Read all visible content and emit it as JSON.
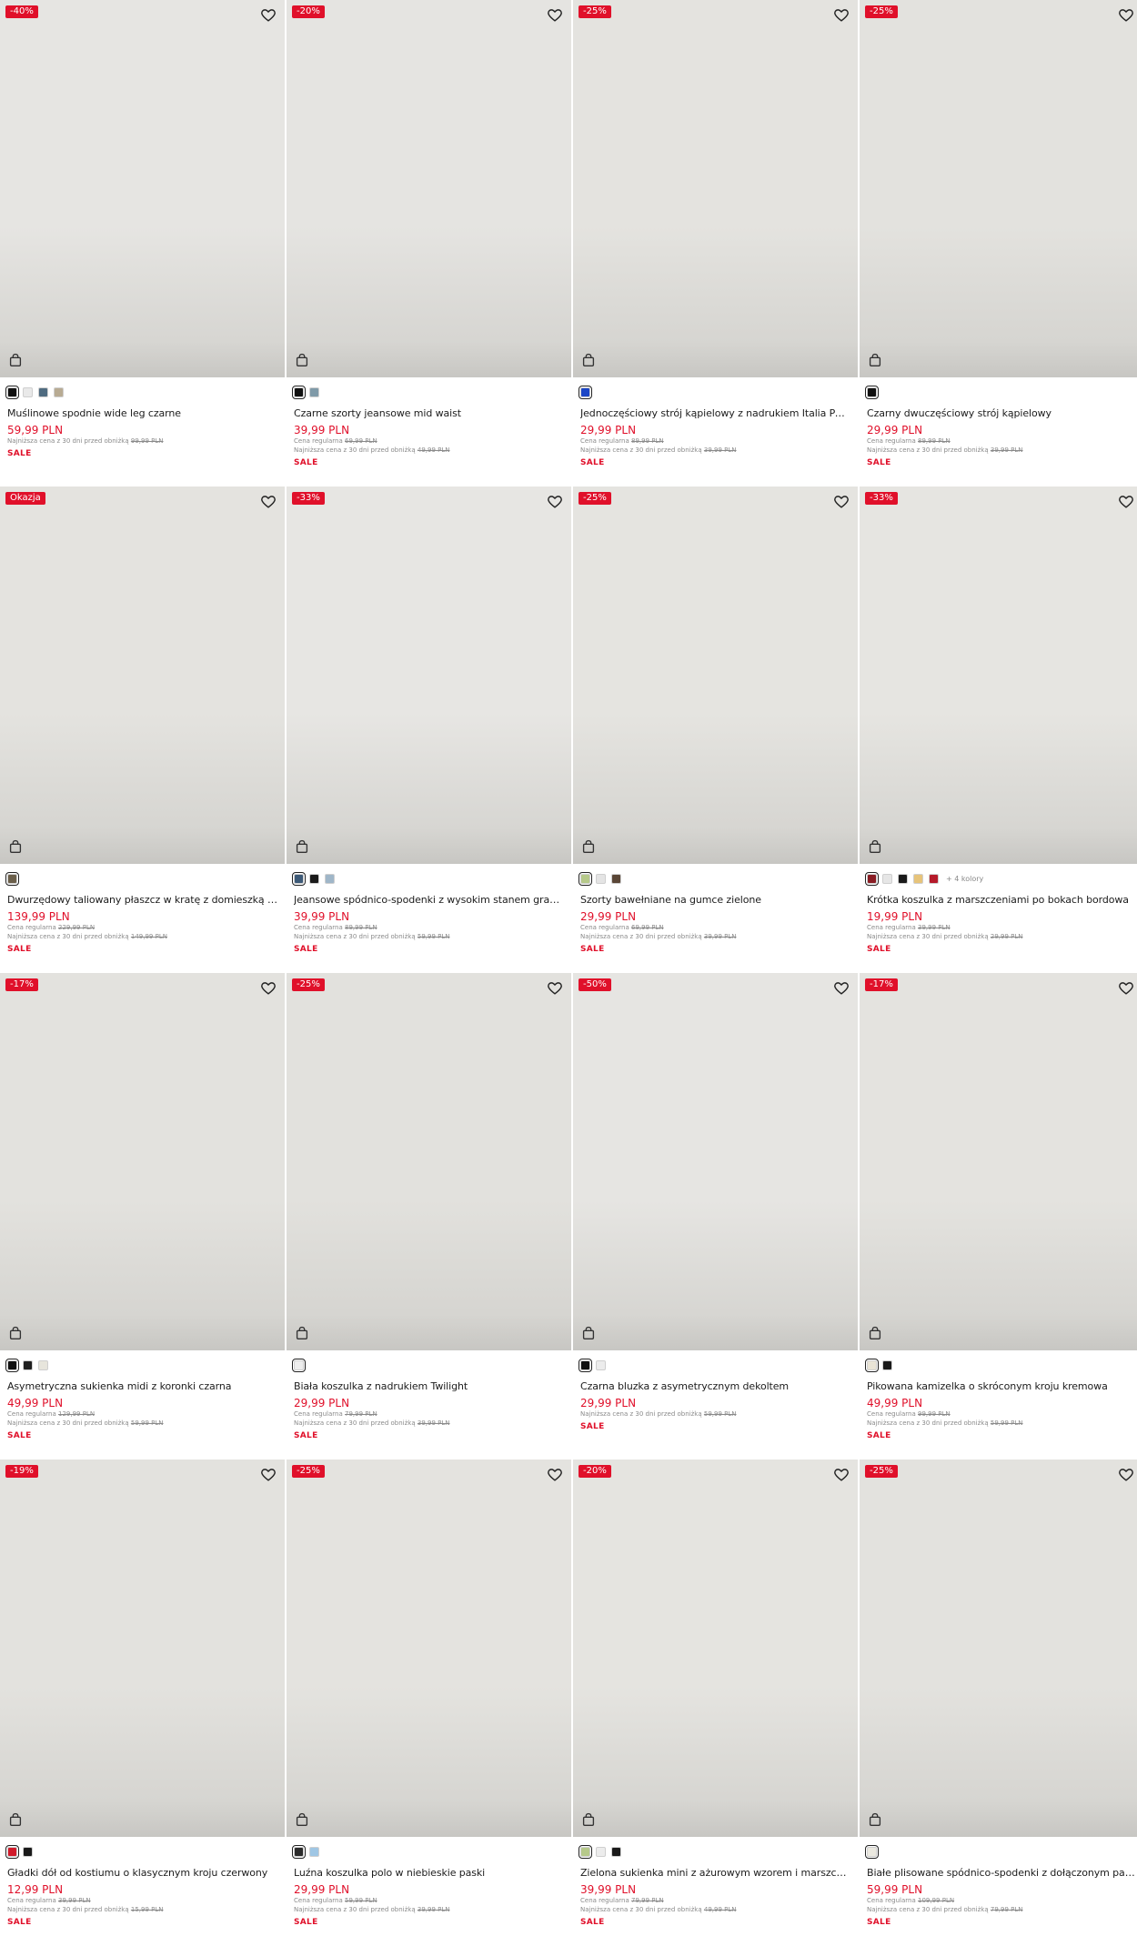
{
  "products": [
    {
      "badge": "-40%",
      "swatches": [
        "#111111",
        "#e9e9e9",
        "#4f6b80",
        "#b8ab93"
      ],
      "more": "",
      "name": "Muślinowe spodnie wide leg czarne",
      "price": "59,99 PLN",
      "regular_label": "",
      "regular_price": "",
      "lowest_label": "Najniższa cena z 30 dni przed obniżką",
      "lowest_price": "99,99 PLN",
      "sale": "SALE",
      "bg": "#e6e5e2",
      "outfit": "#1a1a1a",
      "top": "#1a1a1a",
      "bottom": "#1a1a1a",
      "pose": "long"
    },
    {
      "badge": "-20%",
      "swatches": [
        "#111111",
        "#7f9aa8"
      ],
      "more": "",
      "name": "Czarne szorty jeansowe mid waist",
      "price": "39,99 PLN",
      "regular_label": "Cena regularna",
      "regular_price": "69,99 PLN",
      "lowest_label": "Najniższa cena z 30 dni przed obniżką",
      "lowest_price": "49,99 PLN",
      "sale": "SALE",
      "bg": "#e5e4e1",
      "outfit": "#f5f5f5",
      "top": "#f5f5f5",
      "bottom": "#1a1a1a",
      "pose": "shorts"
    },
    {
      "badge": "-25%",
      "swatches": [
        "#1b46c7"
      ],
      "more": "",
      "name": "Jednoczęściowy strój kąpielowy z nadrukiem Italia Palermo",
      "price": "29,99 PLN",
      "regular_label": "Cena regularna",
      "regular_price": "89,99 PLN",
      "lowest_label": "Najniższa cena z 30 dni przed obniżką",
      "lowest_price": "39,99 PLN",
      "sale": "SALE",
      "bg": "#e4e3df",
      "outfit": "#1b46c7",
      "top": "#1b46c7",
      "bottom": "#1b46c7",
      "pose": "swim"
    },
    {
      "badge": "-25%",
      "swatches": [
        "#111111"
      ],
      "more": "",
      "name": "Czarny dwuczęściowy strój kąpielowy",
      "price": "29,99 PLN",
      "regular_label": "Cena regularna",
      "regular_price": "89,99 PLN",
      "lowest_label": "Najniższa cena z 30 dni przed obniżką",
      "lowest_price": "39,99 PLN",
      "sale": "SALE",
      "bg": "#e3e2de",
      "outfit": "#1a1a1a",
      "top": "#1a1a1a",
      "bottom": "#1a1a1a",
      "pose": "bikini"
    },
    {
      "badge": "Okazja",
      "swatches": [
        "#6b5f4a"
      ],
      "more": "",
      "name": "Dwurzędowy taliowany płaszcz w kratę z domieszką wełny",
      "price": "139,99 PLN",
      "regular_label": "Cena regularna",
      "regular_price": "229,99 PLN",
      "lowest_label": "Najniższa cena z 30 dni przed obniżką",
      "lowest_price": "149,99 PLN",
      "sale": "SALE",
      "bg": "#e4e3df",
      "outfit": "#7a6a52",
      "top": "#7a6a52",
      "bottom": "#2a2420",
      "pose": "coat"
    },
    {
      "badge": "-33%",
      "swatches": [
        "#3d5a78",
        "#1a1a1a",
        "#9fb6c8"
      ],
      "more": "",
      "name": "Jeansowe spódnico-spodenki z wysokim stanem granato...",
      "price": "39,99 PLN",
      "regular_label": "Cena regularna",
      "regular_price": "89,99 PLN",
      "lowest_label": "Najniższa cena z 30 dni przed obniżką",
      "lowest_price": "59,99 PLN",
      "sale": "SALE",
      "bg": "#e7e6e3",
      "outfit": "#4d6e8e",
      "top": "#4d6e8e",
      "bottom": "#4d6e8e",
      "pose": "flat"
    },
    {
      "badge": "-25%",
      "swatches": [
        "#b6c98a",
        "#e4e4e4",
        "#5a4636"
      ],
      "more": "",
      "name": "Szorty bawełniane na gumce zielone",
      "price": "29,99 PLN",
      "regular_label": "Cena regularna",
      "regular_price": "69,99 PLN",
      "lowest_label": "Najniższa cena z 30 dni przed obniżką",
      "lowest_price": "39,99 PLN",
      "sale": "SALE",
      "bg": "#e5e4e0",
      "outfit": "#f2f1ec",
      "top": "#f2f1ec",
      "bottom": "#b8cc8a",
      "pose": "shorts"
    },
    {
      "badge": "-33%",
      "swatches": [
        "#8a1d24",
        "#e6e6e6",
        "#1a1a1a",
        "#e7c47a",
        "#b51a2a"
      ],
      "more": "+ 4 kolory",
      "name": "Krótka koszulka z marszczeniami po bokach bordowa",
      "price": "19,99 PLN",
      "regular_label": "Cena regularna",
      "regular_price": "39,99 PLN",
      "lowest_label": "Najniższa cena z 30 dni przed obniżką",
      "lowest_price": "29,99 PLN",
      "sale": "SALE",
      "bg": "#e6e5e1",
      "outfit": "#8e1c26",
      "top": "#8e1c26",
      "bottom": "#6e5a44",
      "pose": "skirt"
    },
    {
      "badge": "-17%",
      "swatches": [
        "#111111",
        "#1f1f1f",
        "#e7e5dc"
      ],
      "more": "",
      "name": "Asymetryczna sukienka midi z koronki czarna",
      "price": "49,99 PLN",
      "regular_label": "Cena regularna",
      "regular_price": "129,99 PLN",
      "lowest_label": "Najniższa cena z 30 dni przed obniżką",
      "lowest_price": "59,99 PLN",
      "sale": "SALE",
      "bg": "#e3e2de",
      "outfit": "#1a1a1a",
      "top": "#1a1a1a",
      "bottom": "#1a1a1a",
      "pose": "dress"
    },
    {
      "badge": "-25%",
      "swatches": [
        "#eeeeee"
      ],
      "more": "",
      "name": "Biała koszulka z nadrukiem Twilight",
      "price": "29,99 PLN",
      "regular_label": "Cena regularna",
      "regular_price": "79,99 PLN",
      "lowest_label": "Najniższa cena z 30 dni przed obniżką",
      "lowest_price": "39,99 PLN",
      "sale": "SALE",
      "bg": "#e2e1dd",
      "outfit": "#f4f4f4",
      "top": "#f4f4f4",
      "bottom": "#2a2a2a",
      "pose": "tee"
    },
    {
      "badge": "-50%",
      "swatches": [
        "#111111",
        "#ececec"
      ],
      "more": "",
      "name": "Czarna bluzka z asymetrycznym dekoltem",
      "price": "29,99 PLN",
      "regular_label": "",
      "regular_price": "",
      "lowest_label": "Najniższa cena z 30 dni przed obniżką",
      "lowest_price": "59,99 PLN",
      "sale": "SALE",
      "bg": "#e6e5e2",
      "outfit": "#1a1a1a",
      "top": "#1a1a1a",
      "bottom": "#1a1a1a",
      "pose": "tee"
    },
    {
      "badge": "-17%",
      "swatches": [
        "#e9e4d6",
        "#1a1a1a"
      ],
      "more": "",
      "name": "Pikowana kamizelka o skróconym kroju kremowa",
      "price": "49,99 PLN",
      "regular_label": "Cena regularna",
      "regular_price": "99,99 PLN",
      "lowest_label": "Najniższa cena z 30 dni przed obniżką",
      "lowest_price": "59,99 PLN",
      "sale": "SALE",
      "bg": "#e4e3df",
      "outfit": "#efeadc",
      "top": "#efeadc",
      "bottom": "#6f8aa6",
      "pose": "vest"
    },
    {
      "badge": "-19%",
      "swatches": [
        "#d11a2a",
        "#1a1a1a"
      ],
      "more": "",
      "name": "Gładki dół od kostiumu o klasycznym kroju czerwony",
      "price": "12,99 PLN",
      "regular_label": "Cena regularna",
      "regular_price": "39,99 PLN",
      "lowest_label": "Najniższa cena z 30 dni przed obniżką",
      "lowest_price": "15,99 PLN",
      "sale": "SALE",
      "bg": "#e3e2de",
      "outfit": "#d11a2a",
      "top": "#d11a2a",
      "bottom": "#d11a2a",
      "pose": "bikini"
    },
    {
      "badge": "-25%",
      "swatches": [
        "#2b2b2b",
        "#9fc6e4"
      ],
      "more": "",
      "name": "Luźna koszulka polo w niebieskie paski",
      "price": "29,99 PLN",
      "regular_label": "Cena regularna",
      "regular_price": "59,99 PLN",
      "lowest_label": "Najniższa cena z 30 dni przed obniżką",
      "lowest_price": "39,99 PLN",
      "sale": "SALE",
      "bg": "#e4e3df",
      "outfit": "#9fc6e4",
      "top": "#9fc6e4",
      "bottom": "#f4f2ea",
      "pose": "skirt"
    },
    {
      "badge": "-20%",
      "swatches": [
        "#b6c98a",
        "#ececec",
        "#1a1a1a"
      ],
      "more": "",
      "name": "Zielona sukienka mini z ażurowym wzorem i marszczenia...",
      "price": "39,99 PLN",
      "regular_label": "Cena regularna",
      "regular_price": "79,99 PLN",
      "lowest_label": "Najniższa cena z 30 dni przed obniżką",
      "lowest_price": "49,99 PLN",
      "sale": "SALE",
      "bg": "#e5e4e0",
      "outfit": "#b5c57e",
      "top": "#b5c57e",
      "bottom": "#b5c57e",
      "pose": "mini"
    },
    {
      "badge": "-25%",
      "swatches": [
        "#ebe9e0"
      ],
      "more": "",
      "name": "Białe plisowane spódnico-spodenki z dołączonym paskiem",
      "price": "59,99 PLN",
      "regular_label": "Cena regularna",
      "regular_price": "109,99 PLN",
      "lowest_label": "Najniższa cena z 30 dni przed obniżką",
      "lowest_price": "79,99 PLN",
      "sale": "SALE",
      "bg": "#e3e2de",
      "outfit": "#c4262b",
      "top": "#c4262b",
      "bottom": "#f4f2ea",
      "pose": "skirt"
    }
  ]
}
